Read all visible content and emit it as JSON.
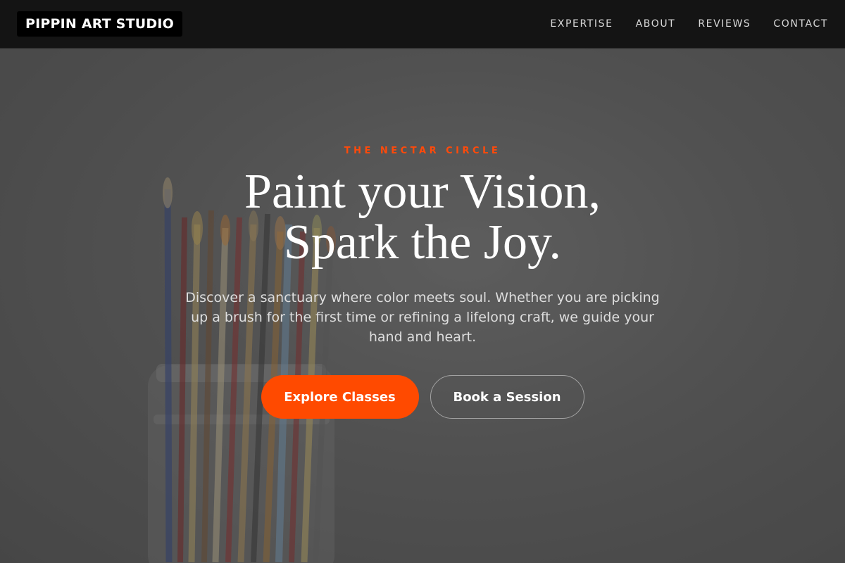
{
  "header": {
    "brand": "PIPPIN ART STUDIO",
    "nav": [
      {
        "label": "EXPERTISE"
      },
      {
        "label": "ABOUT"
      },
      {
        "label": "REVIEWS"
      },
      {
        "label": "CONTACT"
      }
    ]
  },
  "hero": {
    "eyebrow": "THE NECTAR CIRCLE",
    "headline_line1": "Paint your Vision,",
    "headline_line2": "Spark the Joy.",
    "lede": "Discover a sanctuary where color meets soul. Whether you are picking up a brush for the first time or refining a lifelong craft, we guide your hand and heart.",
    "primary_button": "Explore Classes",
    "secondary_button": "Book a Session",
    "background_image": "jar-of-paintbrushes"
  },
  "colors": {
    "accent": "#ff4a00",
    "header_bg": "#141414",
    "text_light": "#ffffff"
  }
}
